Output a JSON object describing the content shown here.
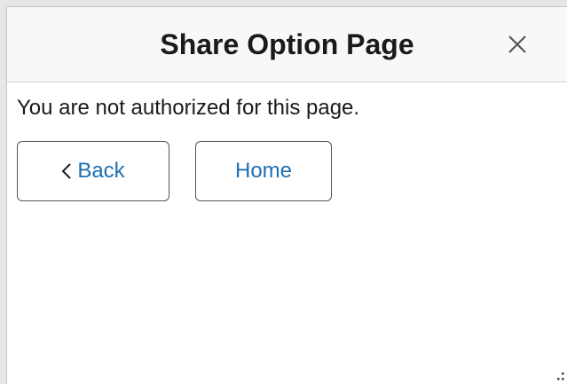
{
  "dialog": {
    "title": "Share Option Page",
    "close_icon": "close-icon",
    "message": "You are not authorized for this page.",
    "back_label": "Back",
    "back_icon": "chevron-left-icon",
    "home_label": "Home",
    "resize_icon": "resize-grip-icon"
  },
  "colors": {
    "header_bg": "#f9f8f6",
    "link_blue": "#1f6fb3",
    "text": "#1a1a1a"
  }
}
